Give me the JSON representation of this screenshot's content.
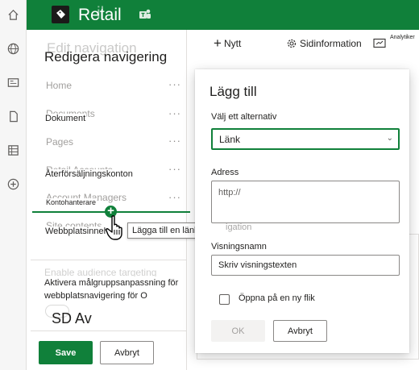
{
  "rail": {
    "icons": [
      "home-icon",
      "globe-icon",
      "news-icon",
      "file-icon",
      "list-icon",
      "add-icon"
    ]
  },
  "header": {
    "site_name": "Retail",
    "site_name_ghost": "il",
    "site_icon": "tag-icon",
    "teams_icon": "teams-icon"
  },
  "nav_pane": {
    "ghost_title": "Edit navigation",
    "title": "Redigera navigering",
    "items": [
      {
        "label": "Home"
      },
      {
        "label": "Documents",
        "overlay": "Dokument"
      },
      {
        "label": "Pages"
      },
      {
        "label": "Retail Accounts",
        "overlay": "Återförsäljningskonton"
      },
      {
        "label": "Account Managers",
        "overlay": "Kontohanterare"
      },
      {
        "label": "Site contents",
        "overlay": "Webbplatsinnehåll"
      }
    ],
    "tooltip": "Lägga till en länketikett",
    "tooltip_tail": "!",
    "audience_ghost": "Enable audience targeting",
    "audience_text": "Aktivera målgruppsanpassning för webbplatsnavigering för O",
    "toggle_state": "SD Av",
    "save_label": "Save",
    "cancel_label": "Avbryt"
  },
  "command_bar": {
    "new_label": "Nytt",
    "page_info_label": "Sidinformation",
    "analytics_label": "Analytiker"
  },
  "dialog": {
    "title": "Lägg till",
    "choose_label": "Välj ett alternativ",
    "choose_value": "Länk",
    "address_label": "Adress",
    "address_value": "http://",
    "address_ghost": "igation",
    "display_label": "Visningsnamn",
    "display_placeholder": "Skriv visningstexten",
    "new_tab_label": "Öppna på en ny flik",
    "ok_label": "OK",
    "cancel_label": "Avbryt"
  },
  "colors": {
    "brand": "#10803a",
    "text": "#201f1e"
  }
}
